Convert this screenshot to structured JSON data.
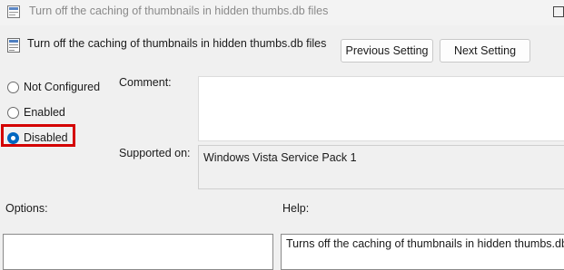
{
  "window": {
    "title": "Turn off the caching of thumbnails in hidden thumbs.db files",
    "icon": "policy-setting-icon"
  },
  "header": {
    "title": "Turn off the caching of thumbnails in hidden thumbs.db files",
    "icon": "policy-setting-icon",
    "previous_label": "Previous Setting",
    "next_label": "Next Setting"
  },
  "state": {
    "options": [
      {
        "label": "Not Configured",
        "checked": false
      },
      {
        "label": "Enabled",
        "checked": false
      },
      {
        "label": "Disabled",
        "checked": true
      }
    ],
    "highlight_color": "#d40000"
  },
  "comment": {
    "label": "Comment:",
    "value": ""
  },
  "supported": {
    "label": "Supported on:",
    "value": "Windows Vista Service Pack 1"
  },
  "options_pane": {
    "label": "Options:"
  },
  "help": {
    "label": "Help:",
    "text": "Turns off the caching of thumbnails in hidden thumbs.db files."
  },
  "colors": {
    "accent": "#0067c0",
    "window_bg": "#f0f0f0"
  }
}
